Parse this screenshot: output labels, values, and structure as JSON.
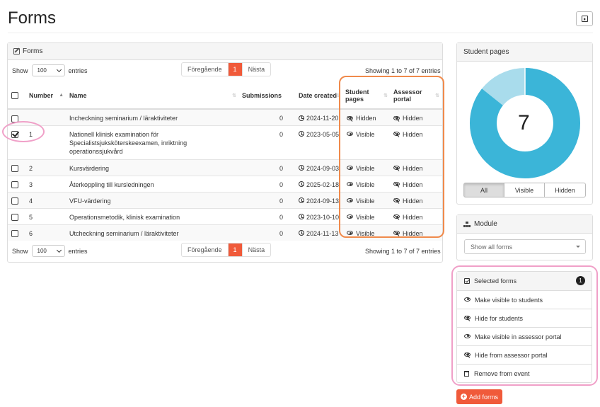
{
  "page": {
    "title": "Forms"
  },
  "forms_panel": {
    "title": "Forms",
    "show_label": "Show",
    "entries_label": "entries",
    "page_length": "100",
    "pager": {
      "prev": "Föregående",
      "current": "1",
      "next": "Nästa"
    },
    "info": "Showing 1 to 7 of 7 entries",
    "columns": [
      "Number",
      "Name",
      "Submissions",
      "Date created",
      "Student pages",
      "Assessor portal"
    ],
    "rows": [
      {
        "checked": false,
        "number": "",
        "name": "Incheckning seminarium / läraktiviteter",
        "submissions": "0",
        "date": "2024-11-20",
        "student": "Hidden",
        "assessor": "Hidden"
      },
      {
        "checked": true,
        "number": "1",
        "name": "Nationell klinisk examination för Specialistsjuksköterskeexamen, inriktning operationssjukvård",
        "submissions": "0",
        "date": "2023-05-05",
        "student": "Visible",
        "assessor": "Hidden"
      },
      {
        "checked": false,
        "number": "2",
        "name": "Kursvärdering",
        "submissions": "0",
        "date": "2024-09-03",
        "student": "Visible",
        "assessor": "Hidden"
      },
      {
        "checked": false,
        "number": "3",
        "name": "Återkoppling till kursledningen",
        "submissions": "0",
        "date": "2025-02-18",
        "student": "Visible",
        "assessor": "Hidden"
      },
      {
        "checked": false,
        "number": "4",
        "name": "VFU-värdering",
        "submissions": "0",
        "date": "2024-09-13",
        "student": "Visible",
        "assessor": "Hidden"
      },
      {
        "checked": false,
        "number": "5",
        "name": "Operationsmetodik, klinisk examination",
        "submissions": "0",
        "date": "2023-10-10",
        "student": "Visible",
        "assessor": "Hidden"
      },
      {
        "checked": false,
        "number": "6",
        "name": "Utcheckning seminarium / läraktiviteter",
        "submissions": "0",
        "date": "2024-11-13",
        "student": "Visible",
        "assessor": "Hidden"
      }
    ]
  },
  "student_pages": {
    "title": "Student pages",
    "count": "7",
    "visible_fraction": 0.857,
    "colors": {
      "visible": "#3bb5d8",
      "hidden": "#a9dcec"
    },
    "filters": [
      "All",
      "Visible",
      "Hidden"
    ]
  },
  "module": {
    "title": "Module",
    "select_value": "Show all forms"
  },
  "selected": {
    "title": "Selected forms",
    "count": "1",
    "actions": [
      "Make visible to students",
      "Hide for students",
      "Make visible in assessor portal",
      "Hide from assessor portal",
      "Remove from event"
    ]
  },
  "add_button": "Add forms"
}
